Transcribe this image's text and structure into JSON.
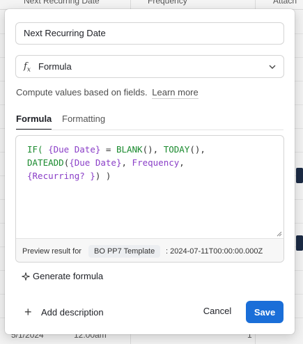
{
  "background": {
    "columns": [
      "Next Recurring Date",
      "Frequency",
      "Attach"
    ],
    "bottom_row": [
      "5/1/2024",
      "12:00am",
      "1"
    ]
  },
  "dialog": {
    "field_name": "Next Recurring Date",
    "field_type": {
      "icon": "formula-fx-icon",
      "label": "Formula"
    },
    "description": "Compute values based on fields.",
    "learn_more": "Learn more",
    "tabs": [
      {
        "label": "Formula",
        "active": true
      },
      {
        "label": "Formatting",
        "active": false
      }
    ],
    "formula": {
      "tokens": {
        "if": "IF(",
        "due_date_1": "{Due Date}",
        "eq": " = ",
        "blank": "BLANK",
        "blank_paren": "(), ",
        "today": "TODAY",
        "today_paren": "(),",
        "dateadd": "DATEADD",
        "dateadd_open": "(",
        "due_date_2": "{Due Date}",
        "comma": ", ",
        "frequency": "Frequency",
        "comma2": ",",
        "recurring": "{Recurring? }",
        "close": ") )"
      }
    },
    "preview": {
      "label": "Preview result for",
      "record": "BO PP7 Template",
      "value": ": 2024-07-11T00:00:00.000Z"
    },
    "generate_formula": "Generate formula",
    "add_description": "Add description",
    "cancel": "Cancel",
    "save": "Save"
  },
  "colors": {
    "accent": "#1a6ed8",
    "function": "#1a8a2e",
    "field_ref": "#8a3ec7"
  }
}
